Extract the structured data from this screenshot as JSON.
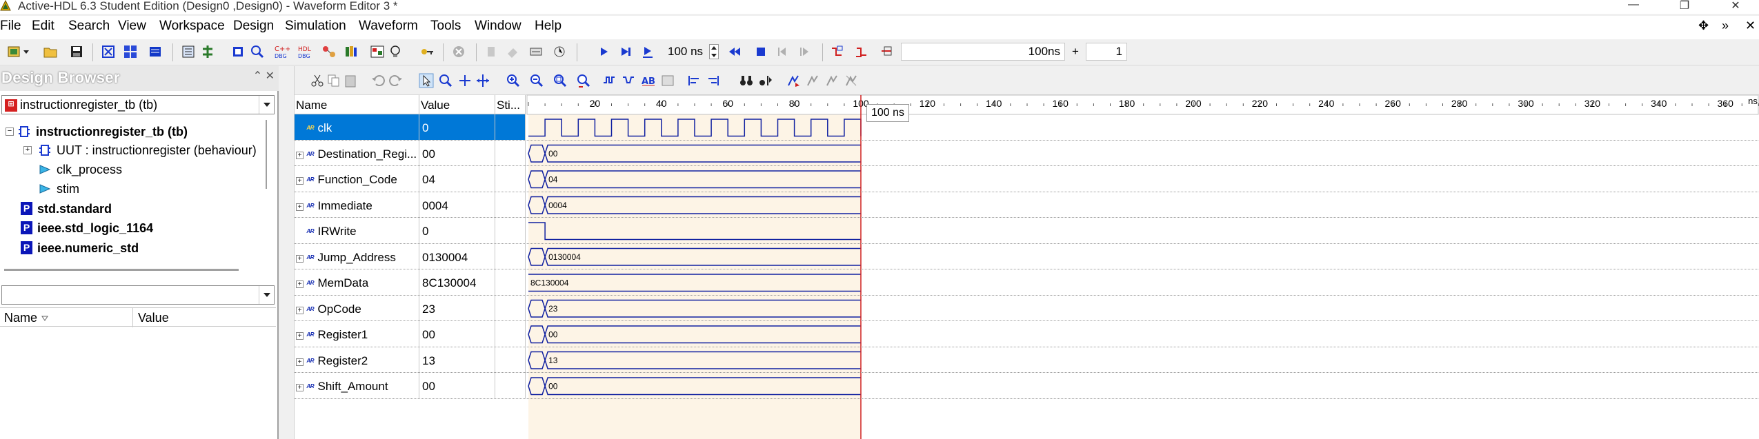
{
  "window": {
    "title": "Active-HDL 6.3 Student Edition (Design0 ,Design0) - Waveform Editor 3 *"
  },
  "menu": [
    "File",
    "Edit",
    "Search",
    "View",
    "Workspace",
    "Design",
    "Simulation",
    "Waveform",
    "Tools",
    "Window",
    "Help"
  ],
  "toolbar": {
    "run_for_value": "100 ns",
    "current_time": "100ns",
    "plus_label": "+",
    "step_count": "1"
  },
  "design_browser": {
    "title": "Design Browser",
    "top_selector": "instructionregister_tb (tb)",
    "tree": [
      {
        "label": "instructionregister_tb (tb)",
        "bold": true
      },
      {
        "label": "UUT : instructionregister (behaviour)",
        "bold": false
      },
      {
        "label": "clk_process",
        "bold": false
      },
      {
        "label": "stim",
        "bold": false
      },
      {
        "label": "std.standard",
        "bold": true
      },
      {
        "label": "ieee.std_logic_1164",
        "bold": true
      },
      {
        "label": "ieee.numeric_std",
        "bold": true
      }
    ],
    "package_icon_letter": "P",
    "grid_columns": [
      "Name",
      "Value"
    ]
  },
  "waveform": {
    "columns": {
      "name": "Name",
      "value": "Value",
      "stimulator": "Sti..."
    },
    "time_unit": "ns",
    "ruler_ticks": [
      "20",
      "40",
      "60",
      "80",
      "100",
      "120",
      "140",
      "160",
      "180",
      "200",
      "220",
      "240",
      "260",
      "280",
      "300",
      "320",
      "340",
      "360"
    ],
    "ruler_end_unit": "ns",
    "cursor_label": "100 ns",
    "cursor_time": 100,
    "sim_end": 100,
    "signals": [
      {
        "name": "clk",
        "value": "0",
        "type": "clock",
        "expandable": false,
        "selected": true
      },
      {
        "name": "Destination_Regi...",
        "value": "00",
        "type": "bus",
        "wave_text": "00",
        "expandable": true
      },
      {
        "name": "Function_Code",
        "value": "04",
        "type": "bus",
        "wave_text": "04",
        "expandable": true
      },
      {
        "name": "Immediate",
        "value": "0004",
        "type": "bus",
        "wave_text": "0004",
        "expandable": true
      },
      {
        "name": "IRWrite",
        "value": "0",
        "type": "bit",
        "expandable": false
      },
      {
        "name": "Jump_Address",
        "value": "0130004",
        "type": "bus",
        "wave_text": "0130004",
        "expandable": true
      },
      {
        "name": "MemData",
        "value": "8C130004",
        "type": "bus_full",
        "wave_text": "8C130004",
        "expandable": true
      },
      {
        "name": "OpCode",
        "value": "23",
        "type": "bus",
        "wave_text": "23",
        "expandable": true
      },
      {
        "name": "Register1",
        "value": "00",
        "type": "bus",
        "wave_text": "00",
        "expandable": true
      },
      {
        "name": "Register2",
        "value": "13",
        "type": "bus",
        "wave_text": "13",
        "expandable": true
      },
      {
        "name": "Shift_Amount",
        "value": "00",
        "type": "bus",
        "wave_text": "00",
        "expandable": true
      }
    ]
  }
}
